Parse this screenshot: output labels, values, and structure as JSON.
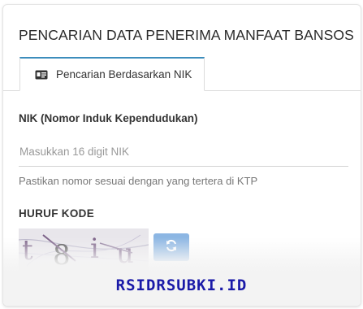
{
  "card": {
    "title": "PENCARIAN DATA PENERIMA MANFAAT BANSOS"
  },
  "tabs": [
    {
      "label": "Pencarian Berdasarkan NIK",
      "icon": "id-card-icon",
      "active": true
    }
  ],
  "form": {
    "nik_label": "NIK (Nomor Induk Kependudukan)",
    "nik_value": "",
    "nik_placeholder": "Masukkan 16 digit NIK",
    "nik_help": "Pastikan nomor sesuai dengan yang tertera di KTP",
    "captcha_label": "HURUF KODE",
    "captcha_text": "t8iu",
    "refresh_icon": "refresh-icon"
  },
  "watermark": "RSIDRSUBKI.ID",
  "colors": {
    "tab_accent": "#3c8dbc",
    "refresh_button": "#8cb6e3",
    "watermark": "#1a1aa8"
  }
}
